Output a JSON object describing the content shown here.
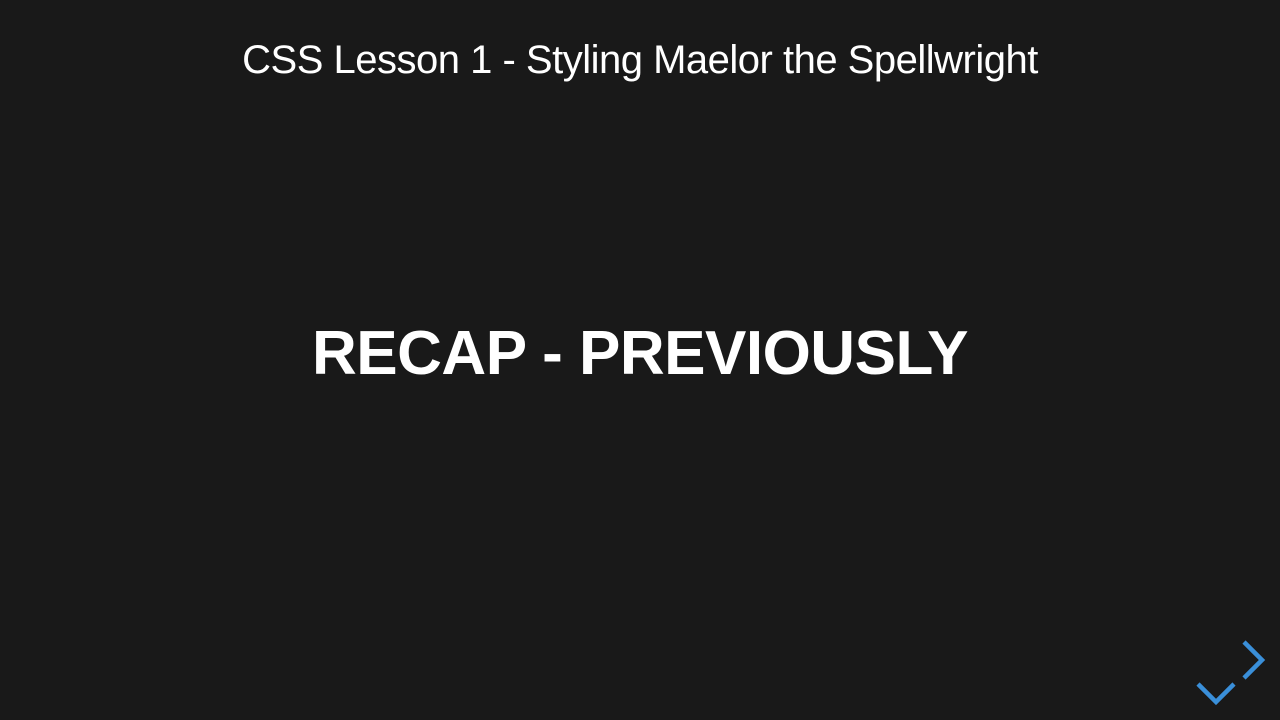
{
  "slide": {
    "deck_title": "CSS Lesson 1 - Styling Maelor the Spellwright",
    "section_heading": "RECAP - PREVIOUSLY"
  },
  "controls": {
    "right_icon": "chevron-right-icon",
    "down_icon": "chevron-down-icon"
  },
  "colors": {
    "background": "#191919",
    "text": "#ffffff",
    "accent": "#3a8fd9"
  }
}
